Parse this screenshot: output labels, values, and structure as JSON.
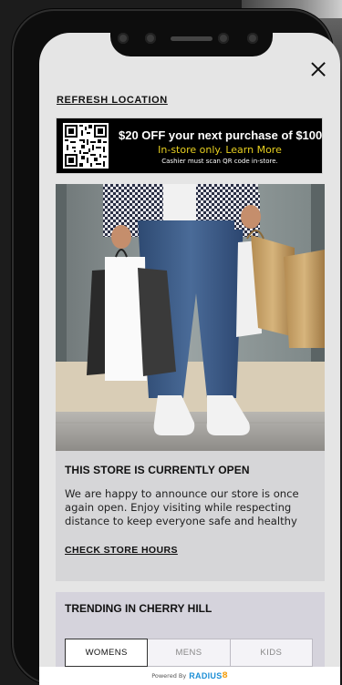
{
  "header": {
    "refresh_label": "REFRESH LOCATION"
  },
  "promo": {
    "headline": "$20 OFF your next purchase of $100",
    "subline": "In-store only. Learn More",
    "note": "Cashier must scan QR code in-store.",
    "accent_color": "#e8d020"
  },
  "status_card": {
    "title": "THIS STORE IS CURRENTLY OPEN",
    "body": "We are happy to announce our store is once again open. Enjoy visiting while respecting distance to keep everyone safe and healthy",
    "link_label": "CHECK STORE HOURS"
  },
  "trending": {
    "title": "TRENDING IN CHERRY HILL",
    "tabs": [
      {
        "label": "WOMENS",
        "active": true
      },
      {
        "label": "MENS",
        "active": false
      },
      {
        "label": "KIDS",
        "active": false
      }
    ]
  },
  "footer": {
    "powered_by": "Powered By",
    "brand": "RADIUS",
    "brand_suffix": "8",
    "brand_color": "#1d8fd6"
  },
  "icons": {
    "close": "close-icon",
    "qr": "qr-code-icon"
  }
}
